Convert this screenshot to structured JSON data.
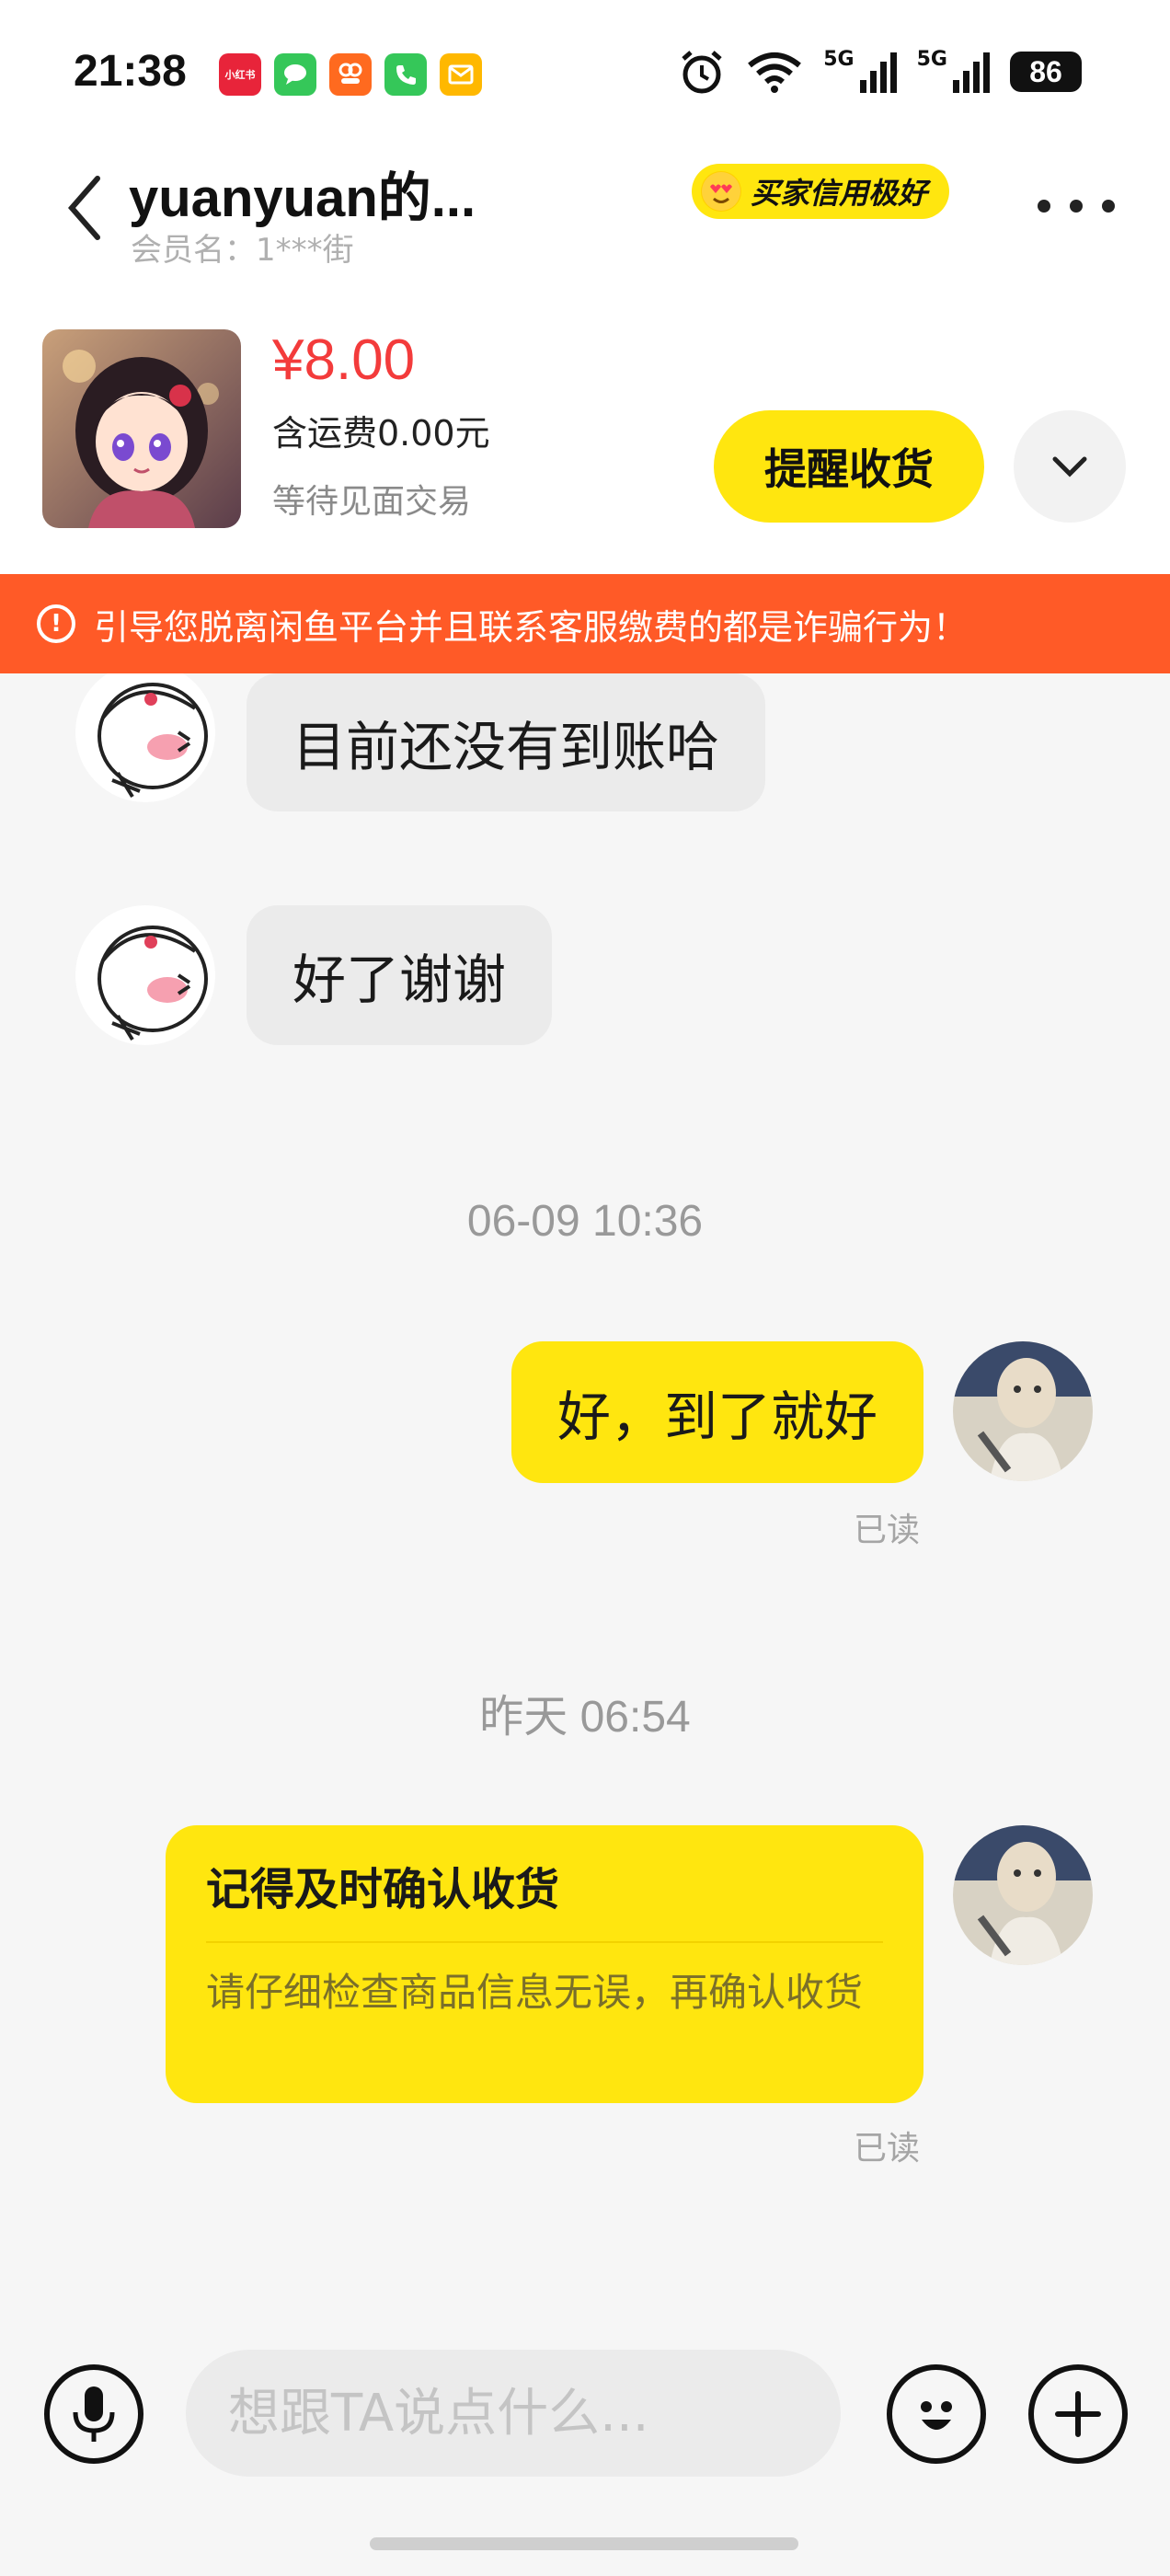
{
  "status_bar": {
    "time": "21:38",
    "app_icons": [
      {
        "name": "xiaohongshu-icon",
        "label": "小红书",
        "color": "#e8243a"
      },
      {
        "name": "messages-icon",
        "label": "",
        "color": "#35c759"
      },
      {
        "name": "app-88-icon",
        "label": "",
        "color": "#ff6a1f"
      },
      {
        "name": "phone-icon",
        "label": "",
        "color": "#35c759"
      },
      {
        "name": "mail-icon",
        "label": "",
        "color": "#ffb800"
      }
    ],
    "net1": "5G",
    "net2": "5G",
    "battery": "86"
  },
  "header": {
    "contact_name": "yuanyuan的...",
    "member_label": "会员名：1***街",
    "credit_badge": "买家信用极好"
  },
  "product": {
    "price": "¥8.00",
    "shipping": "含运费0.00元",
    "status": "等待见面交易",
    "remind_button": "提醒收货"
  },
  "warning": {
    "text": "引导您脱离闲鱼平台并且联系客服缴费的都是诈骗行为！"
  },
  "messages": {
    "m1": "目前还没有到账哈",
    "m2": "好了谢谢",
    "t1": "06-09 10:36",
    "m3": "好，到了就好",
    "read1": "已读",
    "t2": "昨天 06:54",
    "card_title": "记得及时确认收货",
    "card_body": "请仔细检查商品信息无误，再确认收货",
    "read2": "已读"
  },
  "input": {
    "placeholder": "想跟TA说点什么..."
  },
  "colors": {
    "accent_yellow": "#ffe60f",
    "price_red": "#f33b3b",
    "warning_orange": "#ff5a27"
  }
}
